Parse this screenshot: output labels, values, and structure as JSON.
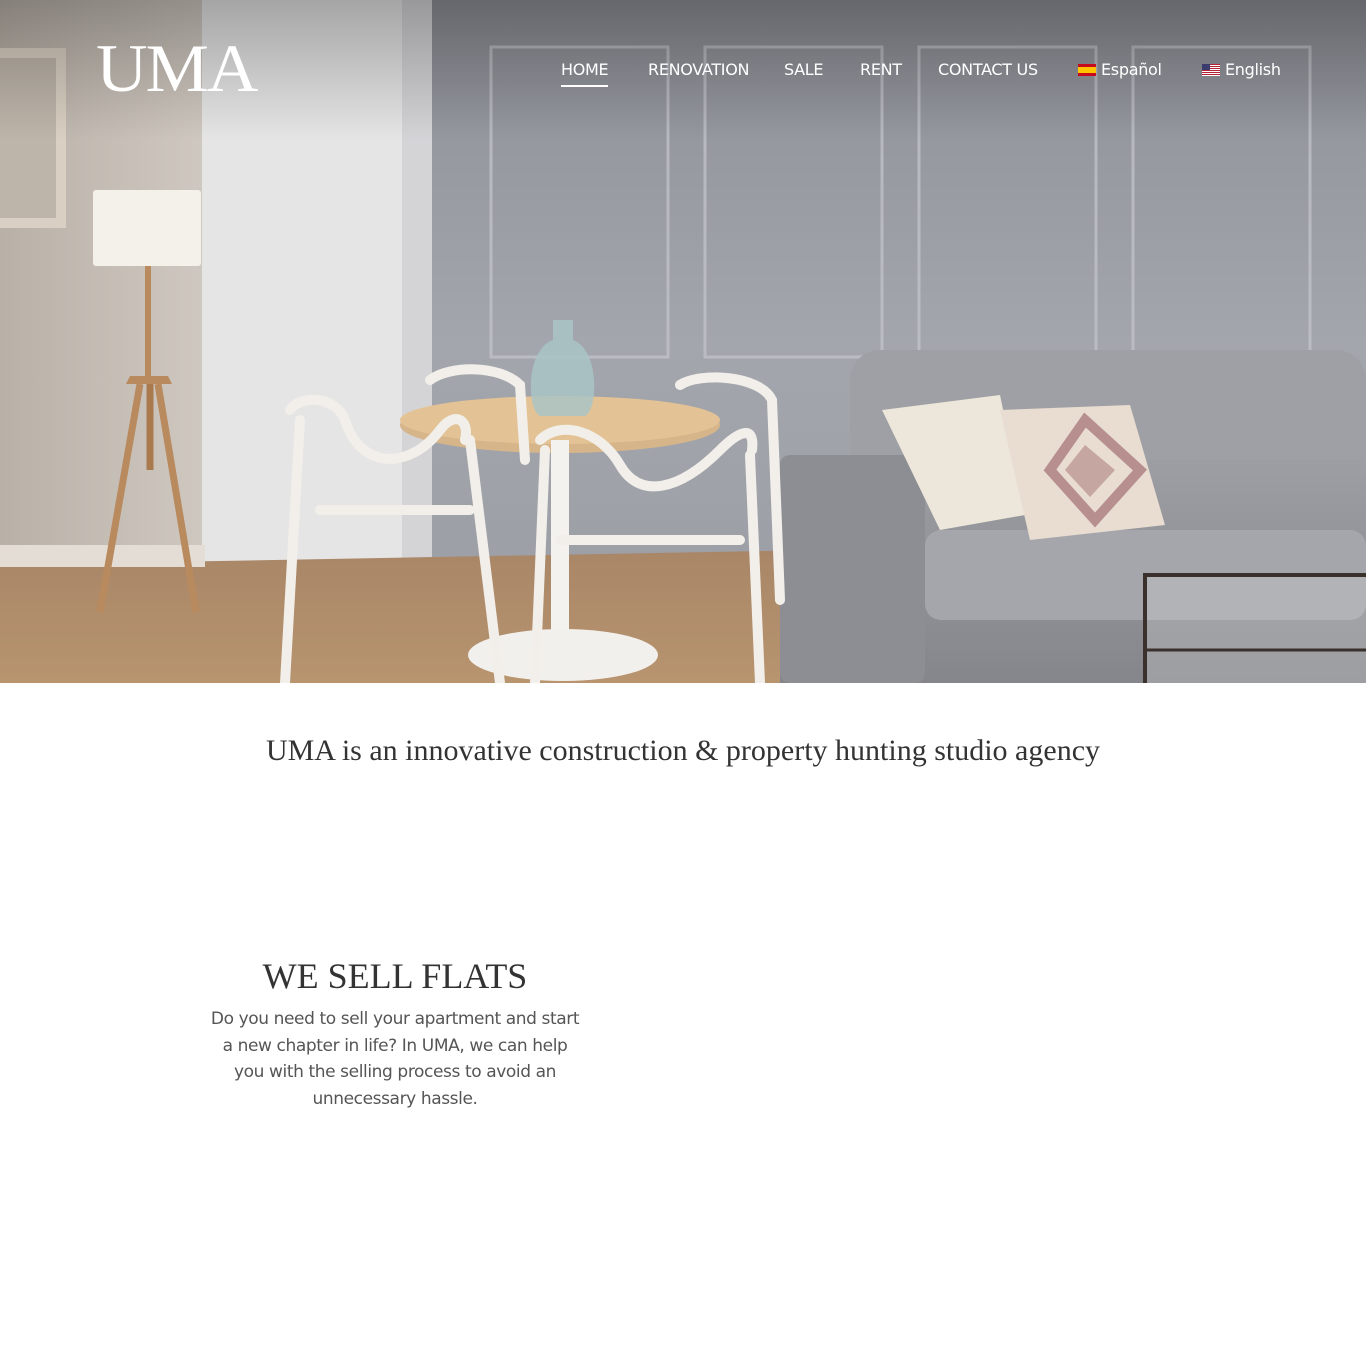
{
  "header": {
    "logo": "UMA",
    "nav": [
      {
        "label": "HOME",
        "active": true
      },
      {
        "label": "RENOVATION",
        "active": false
      },
      {
        "label": "SALE",
        "active": false
      },
      {
        "label": "RENT",
        "active": false
      },
      {
        "label": "CONTACT US",
        "active": false
      }
    ],
    "languages": [
      {
        "label": "Español",
        "flag": "spain-flag-icon"
      },
      {
        "label": "English",
        "flag": "us-flag-icon"
      }
    ]
  },
  "intro": {
    "tagline": "UMA is an innovative construction & property hunting studio agency"
  },
  "sell": {
    "heading": "WE SELL FLATS",
    "body": "Do you need to sell your apartment and start a new chapter in life? In UMA, we can help you with the selling process to avoid an unnecessary hassle."
  },
  "colors": {
    "text_dark": "#333333",
    "text_body": "#555555",
    "nav_text": "#ffffff",
    "background": "#ffffff"
  }
}
